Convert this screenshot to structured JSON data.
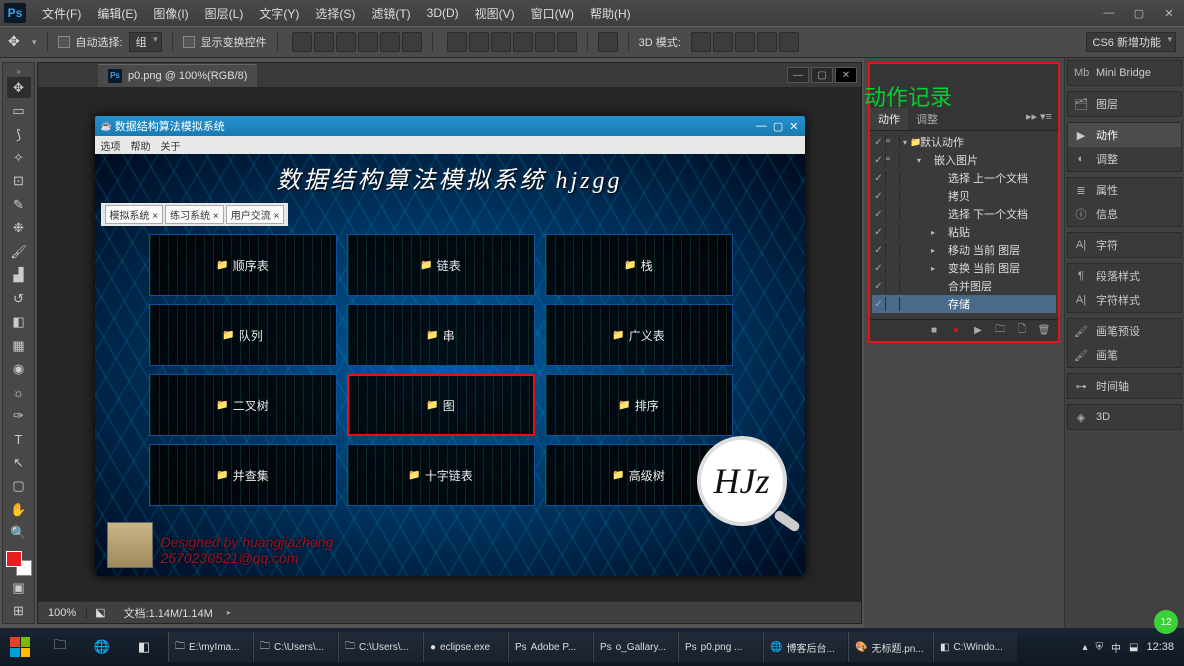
{
  "menubar": {
    "items": [
      "文件(F)",
      "编辑(E)",
      "图像(I)",
      "图层(L)",
      "文字(Y)",
      "选择(S)",
      "滤镜(T)",
      "3D(D)",
      "视图(V)",
      "窗口(W)",
      "帮助(H)"
    ]
  },
  "optionsbar": {
    "auto_select": "自动选择:",
    "group": "组",
    "show_transform": "显示变换控件",
    "mode3d": "3D 模式:",
    "workspace_mode": "CS6 新增功能"
  },
  "document": {
    "tab_title": "p0.png @ 100%(RGB/8)",
    "zoom": "100%",
    "docinfo": "文档:1.14M/1.14M"
  },
  "inner_app": {
    "title": "数据结构算法模拟系统",
    "menubar": [
      "选项",
      "帮助",
      "关于"
    ],
    "headline": "数据结构算法模拟系统 hjzgg",
    "tabs": [
      "模拟系统 ×",
      "练习系统 ×",
      "用户交流 ×"
    ],
    "cells": [
      {
        "label": "顺序表"
      },
      {
        "label": "链表"
      },
      {
        "label": "栈"
      },
      {
        "label": "队列"
      },
      {
        "label": "串"
      },
      {
        "label": "广义表"
      },
      {
        "label": "二叉树"
      },
      {
        "label": "图",
        "hl": true
      },
      {
        "label": "排序"
      },
      {
        "label": "并查集"
      },
      {
        "label": "十字链表"
      },
      {
        "label": "高级树"
      }
    ],
    "monogram": "HJz",
    "designed_line1": "Designed by  huangjiazhong",
    "designed_line2": "2570230521@qq.com"
  },
  "annotation": "动作记录",
  "actions_panel": {
    "tabs": {
      "active": "动作",
      "other": "调整"
    },
    "rows": [
      {
        "indent": 0,
        "tw": "▾",
        "fld": "📁",
        "label": "默认动作",
        "chk": true,
        "mod": true
      },
      {
        "indent": 1,
        "tw": "▾",
        "fld": "",
        "label": "嵌入图片",
        "chk": true,
        "mod": true
      },
      {
        "indent": 2,
        "tw": "",
        "fld": "",
        "label": "选择 上一个文档",
        "chk": true
      },
      {
        "indent": 2,
        "tw": "",
        "fld": "",
        "label": "拷贝",
        "chk": true
      },
      {
        "indent": 2,
        "tw": "",
        "fld": "",
        "label": "选择 下一个文档",
        "chk": true
      },
      {
        "indent": 2,
        "tw": "▸",
        "fld": "",
        "label": "粘贴",
        "chk": true
      },
      {
        "indent": 2,
        "tw": "▸",
        "fld": "",
        "label": "移动 当前 图层",
        "chk": true
      },
      {
        "indent": 2,
        "tw": "▸",
        "fld": "",
        "label": "变换 当前 图层",
        "chk": true
      },
      {
        "indent": 2,
        "tw": "",
        "fld": "",
        "label": "合并图层",
        "chk": true
      },
      {
        "indent": 2,
        "tw": "",
        "fld": "",
        "label": "存储",
        "chk": true,
        "sel": true
      }
    ]
  },
  "dock": {
    "groups": [
      [
        {
          "icon": "Mb",
          "label": "Mini Bridge"
        }
      ],
      [
        {
          "icon": "🗂",
          "label": "图层"
        }
      ],
      [
        {
          "icon": "▶",
          "label": "动作",
          "active": true
        },
        {
          "icon": "◐",
          "label": "调整"
        }
      ],
      [
        {
          "icon": "≣",
          "label": "属性"
        },
        {
          "icon": "ⓘ",
          "label": "信息"
        }
      ],
      [
        {
          "icon": "A|",
          "label": "字符"
        }
      ],
      [
        {
          "icon": "¶",
          "label": "段落样式"
        },
        {
          "icon": "A|",
          "label": "字符样式"
        }
      ],
      [
        {
          "icon": "🖌",
          "label": "画笔预设"
        },
        {
          "icon": "🖌",
          "label": "画笔"
        }
      ],
      [
        {
          "icon": "⊶",
          "label": "时间轴"
        }
      ],
      [
        {
          "icon": "◈",
          "label": "3D"
        }
      ]
    ]
  },
  "taskbar": {
    "running": [
      {
        "icon": "🗀",
        "label": "E:\\myIma..."
      },
      {
        "icon": "🗀",
        "label": "C:\\Users\\..."
      },
      {
        "icon": "🗀",
        "label": "C:\\Users\\..."
      },
      {
        "icon": "●",
        "label": "eclipse.exe"
      },
      {
        "icon": "Ps",
        "label": "Adobe P..."
      },
      {
        "icon": "Ps",
        "label": "o_Gallary..."
      },
      {
        "icon": "Ps",
        "label": "p0.png ..."
      },
      {
        "icon": "🌐",
        "label": "博客后台..."
      },
      {
        "icon": "🎨",
        "label": "无标题.pn..."
      },
      {
        "icon": "◧",
        "label": "C:\\Windo..."
      }
    ],
    "tray": {
      "ime": "中",
      "net": "⬓",
      "clock": "12:38"
    }
  }
}
